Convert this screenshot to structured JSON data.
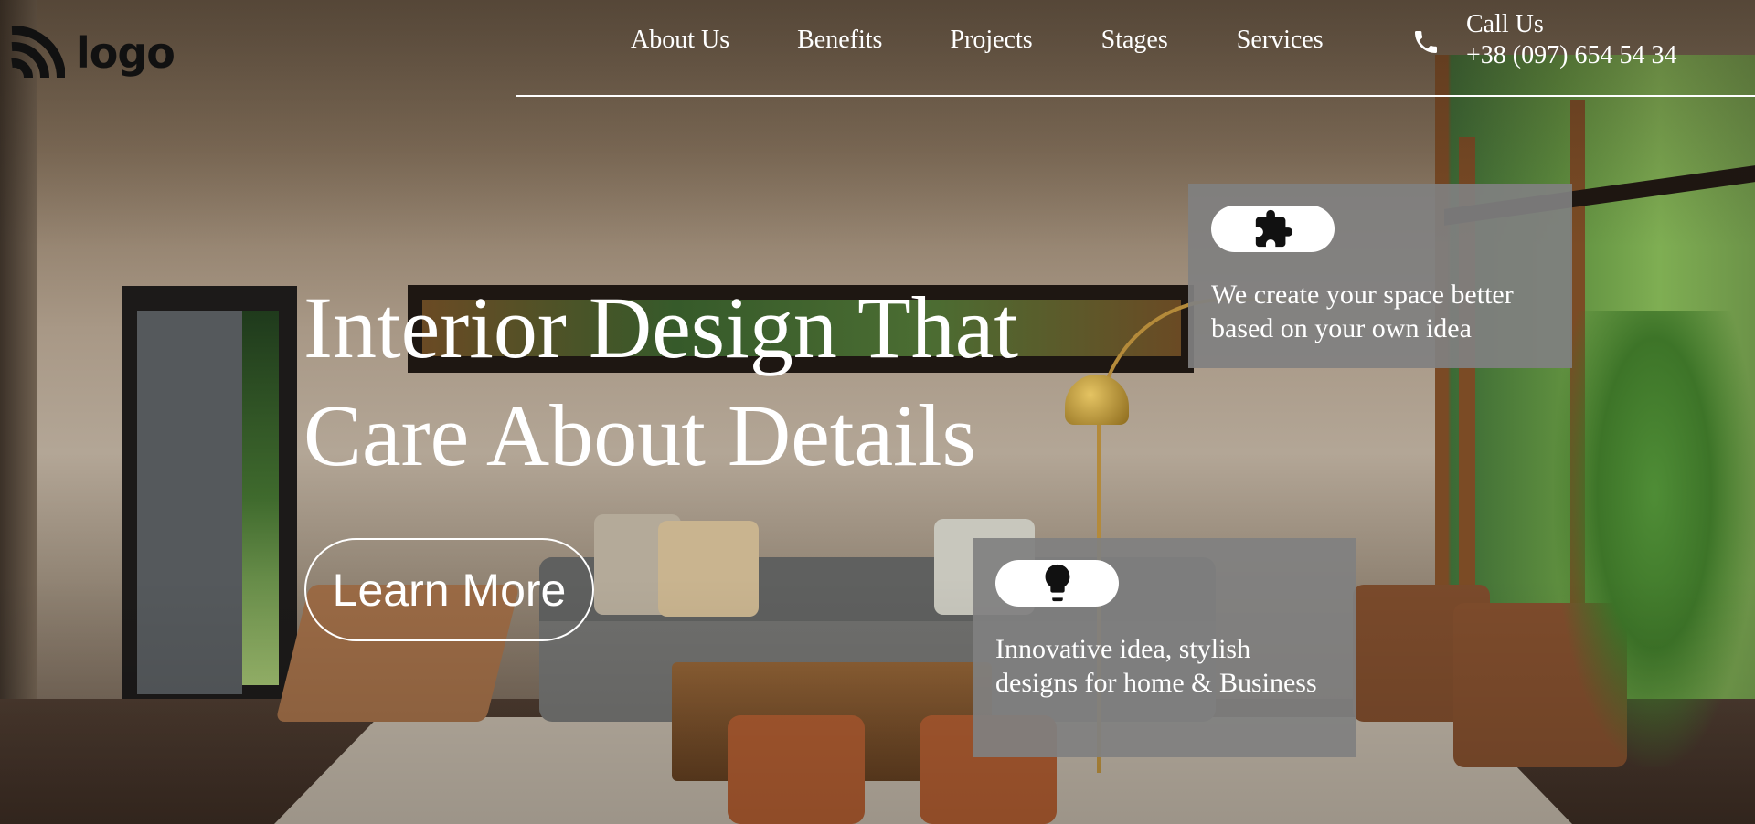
{
  "brand": {
    "logo_text": "logo",
    "logo_icon": "signal-arcs-icon"
  },
  "nav": {
    "items": [
      {
        "label": "About Us"
      },
      {
        "label": "Benefits"
      },
      {
        "label": "Projects"
      },
      {
        "label": "Stages"
      },
      {
        "label": "Services"
      }
    ]
  },
  "contact": {
    "icon": "phone-icon",
    "label": "Call Us",
    "phone": "+38 (097) 654 54 34"
  },
  "hero": {
    "title_line1": "Interior Design That",
    "title_line2": "Care About Details",
    "cta_label": "Learn More"
  },
  "features": [
    {
      "icon": "puzzle-icon",
      "text": "We create your space better based on your own idea"
    },
    {
      "icon": "lightbulb-icon",
      "text": "Innovative idea, stylish designs for home & Business"
    }
  ],
  "colors": {
    "text": "#ffffff",
    "logo": "#111111",
    "card_bg": "#808080",
    "pill_bg": "#ffffff"
  }
}
